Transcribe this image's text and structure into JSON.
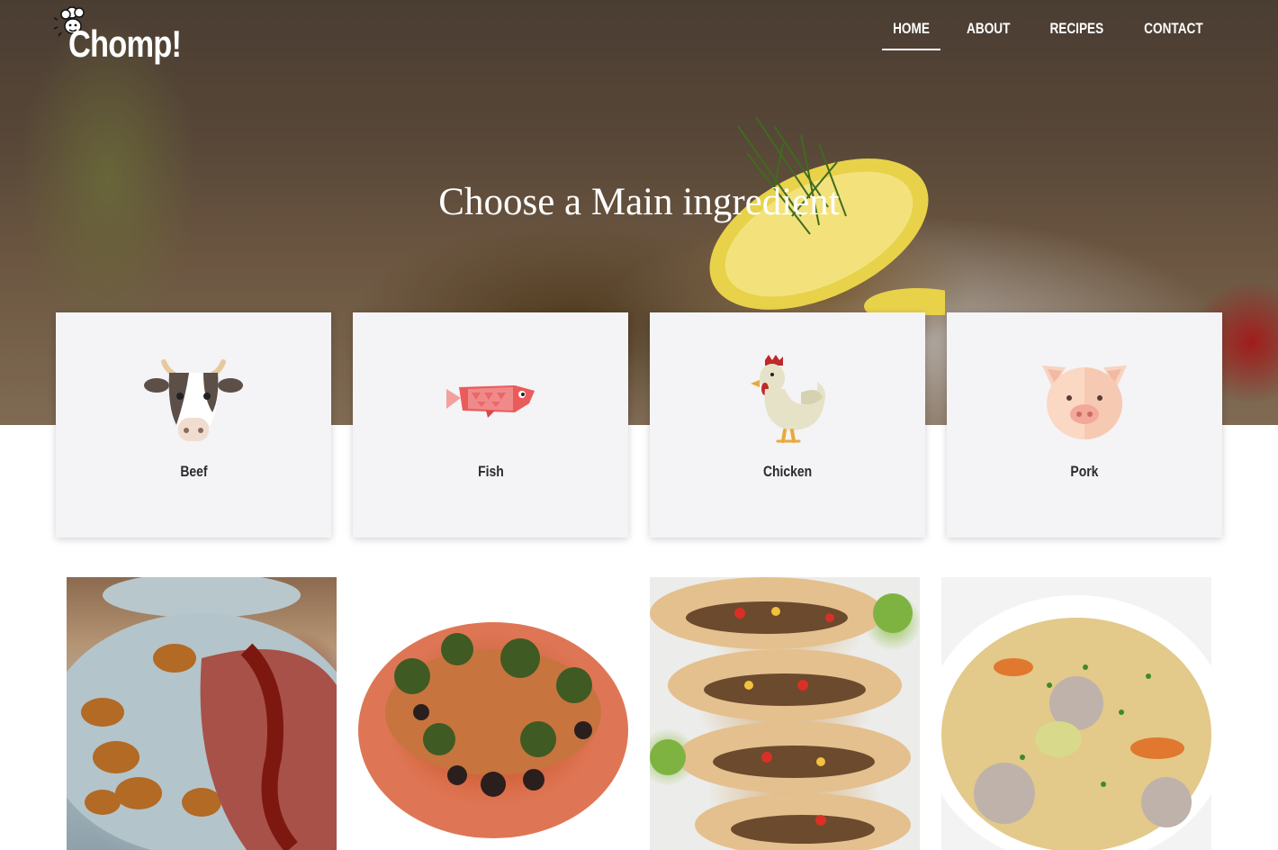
{
  "brand": {
    "name": "Chomp!"
  },
  "nav": {
    "items": [
      {
        "label": "HOME",
        "active": true
      },
      {
        "label": "ABOUT",
        "active": false
      },
      {
        "label": "RECIPES",
        "active": false
      },
      {
        "label": "CONTACT",
        "active": false
      }
    ]
  },
  "hero": {
    "title": "Choose a Main ingredient"
  },
  "ingredients": [
    {
      "label": "Beef",
      "icon": "cow-icon"
    },
    {
      "label": "Fish",
      "icon": "fish-icon"
    },
    {
      "label": "Chicken",
      "icon": "chicken-icon"
    },
    {
      "label": "Pork",
      "icon": "pig-icon"
    }
  ],
  "recipes": [
    {
      "image": "steak-with-potatoes-photo"
    },
    {
      "image": "fish-with-olives-photo"
    },
    {
      "image": "tacos-photo"
    },
    {
      "image": "meatball-soup-photo"
    }
  ],
  "colors": {
    "card_bg": "#f4f3f5",
    "text_dark": "#2b2b2b",
    "nav_text": "#ffffff"
  }
}
